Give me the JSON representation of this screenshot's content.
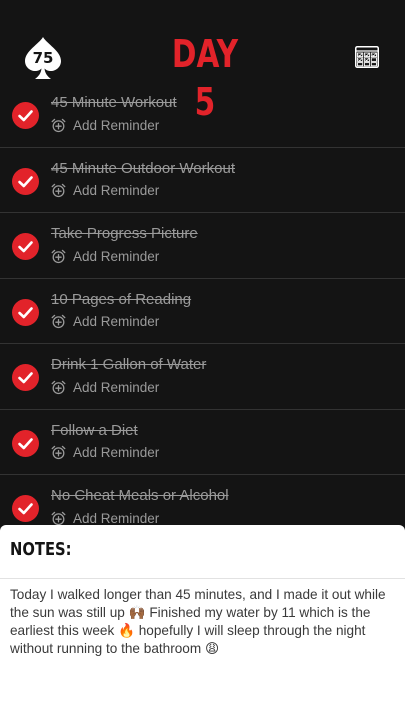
{
  "header": {
    "logo_text": "75",
    "title": "DAY  5",
    "accent_color": "#e2232a",
    "calendar_icon": "calendar-grid-icon"
  },
  "tasks": [
    {
      "name": "45 Minute Workout",
      "reminder": "Add Reminder",
      "completed": true
    },
    {
      "name": "45 Minute Outdoor Workout",
      "reminder": "Add Reminder",
      "completed": true
    },
    {
      "name": "Take Progress Picture",
      "reminder": "Add Reminder",
      "completed": true
    },
    {
      "name": "10 Pages of Reading",
      "reminder": "Add Reminder",
      "completed": true
    },
    {
      "name": "Drink 1 Gallon of Water",
      "reminder": "Add Reminder",
      "completed": true
    },
    {
      "name": "Follow a Diet",
      "reminder": "Add Reminder",
      "completed": true
    },
    {
      "name": "No Cheat Meals or Alcohol",
      "reminder": "Add Reminder",
      "completed": true
    }
  ],
  "notes": {
    "title": "NOTES:",
    "text": "Today I walked longer than 45 minutes, and I made it out while the sun was still up 🙌🏾 Finished my water by 11 which is the earliest this week 🔥 hopefully I will sleep through the night without running to the bathroom 😩"
  }
}
